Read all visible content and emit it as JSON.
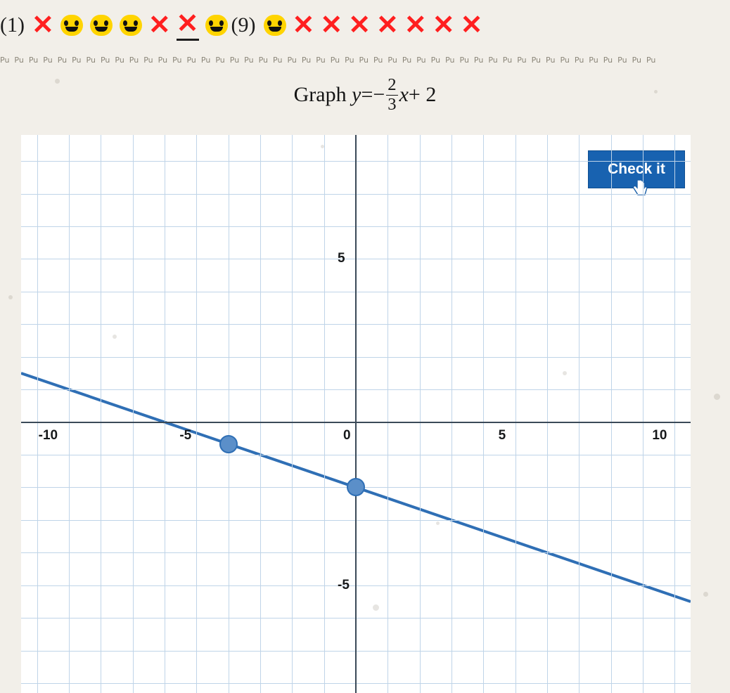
{
  "topbar": {
    "left_counter": "(1)",
    "right_counter": "(9)",
    "items": [
      {
        "type": "x",
        "underline": false
      },
      {
        "type": "smiley"
      },
      {
        "type": "smiley"
      },
      {
        "type": "smiley"
      },
      {
        "type": "x",
        "underline": false
      },
      {
        "type": "x",
        "underline": true
      },
      {
        "type": "smiley"
      },
      {
        "type": "counter_right"
      },
      {
        "type": "smiley"
      },
      {
        "type": "x",
        "underline": false
      },
      {
        "type": "x",
        "underline": false
      },
      {
        "type": "x",
        "underline": false
      },
      {
        "type": "x",
        "underline": false
      },
      {
        "type": "x",
        "underline": false
      },
      {
        "type": "x",
        "underline": false
      },
      {
        "type": "x",
        "underline": false
      }
    ],
    "x_glyph": "✕",
    "x_color": "#ff1f1f",
    "smiley_color": "#ffd400"
  },
  "strip": {
    "repeat_text": "Pu",
    "count": 46
  },
  "prompt": {
    "label": "Graph",
    "equation_y": "y",
    "equals": "=",
    "minus": "−",
    "numerator": "2",
    "denominator": "3",
    "variable": "x",
    "plus_term": "+ 2"
  },
  "button": {
    "check_label": "Check it",
    "color": "#1862b0",
    "text_color": "#ffffff"
  },
  "chart_data": {
    "type": "line",
    "title": "Graph y = -2/3 x + 2",
    "xlabel": "",
    "ylabel": "",
    "xlim": [
      -10.5,
      10.5
    ],
    "ylim": [
      -8.3,
      8.8
    ],
    "grid": true,
    "grid_step": 1,
    "x_ticks": [
      -10,
      -5,
      0,
      5,
      10
    ],
    "x_tick_labels": [
      "-10",
      "-5",
      "0",
      "5",
      "10"
    ],
    "y_ticks": [
      -5,
      5
    ],
    "y_tick_labels": [
      "-5",
      "5"
    ],
    "series": [
      {
        "name": "y = -2/3 x + 2",
        "color": "#2f6fb5",
        "slope": -0.3333,
        "intercept": -2,
        "x": [
          -10.5,
          10.5
        ],
        "y": [
          1.5,
          -5.5
        ]
      }
    ],
    "points": [
      {
        "x": -4.0,
        "y": -0.67,
        "color": "#5b8fc9"
      },
      {
        "x": 0.0,
        "y": -2.0,
        "color": "#5b8fc9"
      }
    ],
    "axis_color": "#3b4a58",
    "gridline_color": "#bfd4e8"
  }
}
